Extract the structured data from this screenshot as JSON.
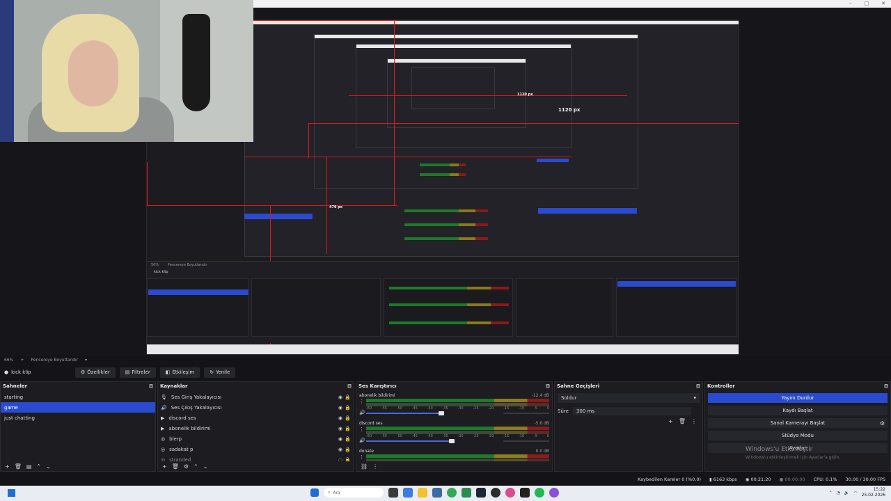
{
  "preview": {
    "px_label_large": "1120 px",
    "px_label_mid": "1120 px",
    "px_label_small": "479 px",
    "mini_footer_zoom": "56%",
    "mini_footer_mode": "Pencereye Boyutlandır",
    "mini_scene": "kick klip"
  },
  "preview_footer": {
    "zoom": "66%",
    "mode": "Pencereye Boyutlandır"
  },
  "toolbar": {
    "scene_name": "kick klip",
    "properties": "Özellikler",
    "filters": "Filtreler",
    "interact": "Etkileşim",
    "refresh": "Yenile"
  },
  "scenes": {
    "title": "Sahneler",
    "items": [
      {
        "label": "starting",
        "selected": false
      },
      {
        "label": "game",
        "selected": true
      },
      {
        "label": "just chatting",
        "selected": false
      }
    ]
  },
  "sources": {
    "title": "Kaynaklar",
    "items": [
      {
        "label": "Ses Giriş Yakalayıcısı",
        "icon": "mic-icon"
      },
      {
        "label": "Ses Çıkış Yakalayıcısı",
        "icon": "speaker-icon"
      },
      {
        "label": "discord ses",
        "icon": "media-icon"
      },
      {
        "label": "abonelik bildirimi",
        "icon": "media-icon"
      },
      {
        "label": "blerp",
        "icon": "browser-icon"
      },
      {
        "label": "sadakat p",
        "icon": "browser-icon"
      },
      {
        "label": "stranded",
        "icon": "browser-icon"
      }
    ]
  },
  "mixer": {
    "title": "Ses Karıştırıcı",
    "scale": [
      "-60",
      "-55",
      "-50",
      "-45",
      "-40",
      "-35",
      "-30",
      "-25",
      "-20",
      "-15",
      "-10",
      "-5",
      "0"
    ],
    "channels": [
      {
        "name": "abonelik bildirimi",
        "db": "-12.4 dB",
        "level": 0.72
      },
      {
        "name": "discord ses",
        "db": "-5.6 dB",
        "level": 0.82
      },
      {
        "name": "donate",
        "db": "0.0 dB",
        "level": 1.0
      }
    ]
  },
  "transitions": {
    "title": "Sahne Geçişleri",
    "selected": "Soldur",
    "duration_label": "Süre",
    "duration_value": "300 ms"
  },
  "controls": {
    "title": "Kontroller",
    "stop_stream": "Yayını Durdur",
    "start_record": "Kaydı Başlat",
    "virtual_cam": "Sanal Kamerayı Başlat",
    "studio_mode": "Stüdyo Modu",
    "settings": "Ayarlar",
    "watermark_title": "Windows'u Etkinleştir",
    "watermark_sub": "Windows'u etkinleştirmek için Ayarlar'a gidin."
  },
  "status": {
    "dropped": "Kaybedilen Kareler 0 (%0.0)",
    "bitrate": "6163 kbps",
    "stream_time": "00:21:20",
    "rec_time": "00:00:00",
    "cpu": "CPU: 0.1%",
    "fps": "30.00 / 30.00 FPS"
  },
  "taskbar": {
    "search_placeholder": "Ara",
    "time": "15:22",
    "date": "25.02.2026"
  },
  "colors": {
    "accent": "#2a4bd0",
    "guide_red": "#e01a1a",
    "meter_green": "#1f7a2c",
    "meter_yellow": "#8c7c1c",
    "meter_red": "#8a1c1c"
  }
}
